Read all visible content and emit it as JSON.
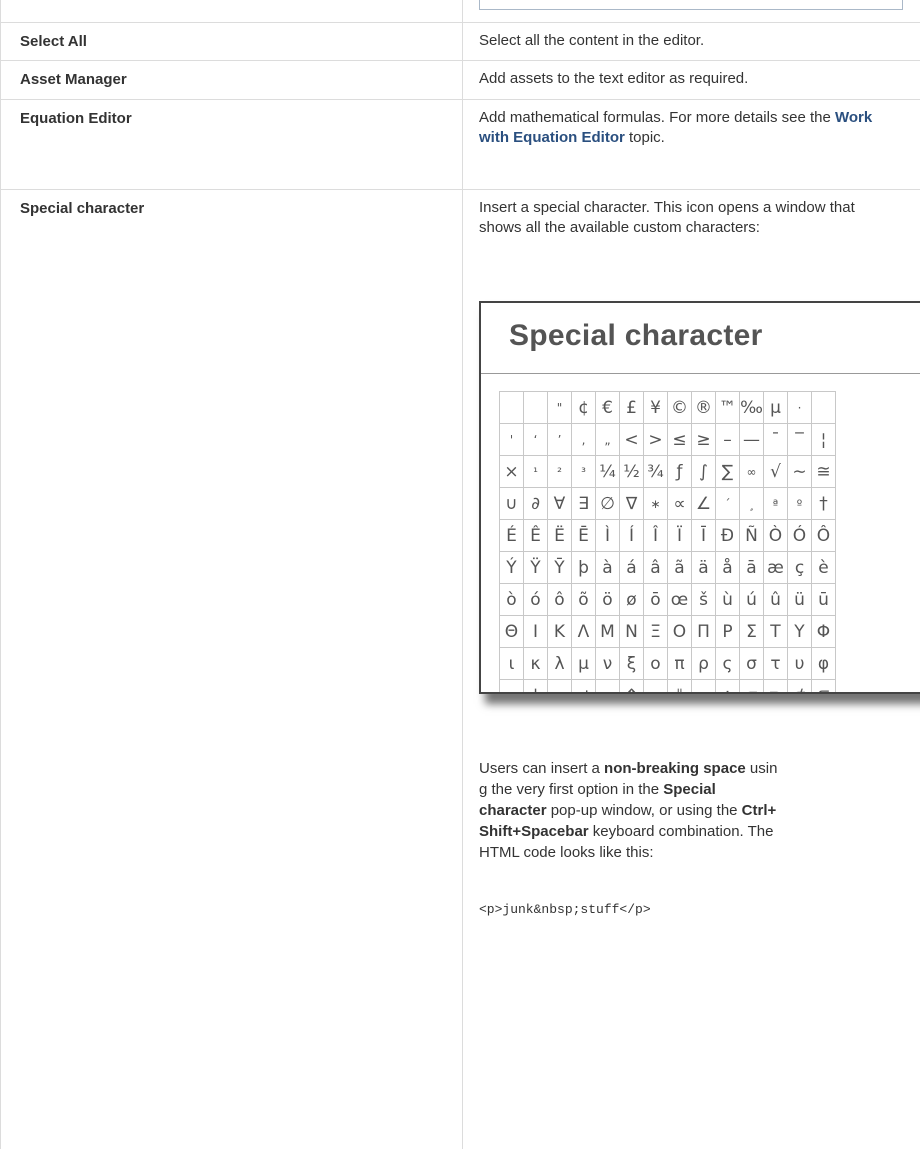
{
  "rows": [
    {
      "label": "Select All",
      "description": "Select all the content in the editor."
    },
    {
      "label": "Asset Manager",
      "description": "Add assets to the text editor as required."
    },
    {
      "label": "Equation Editor",
      "description_pre": "Add mathematical formulas. For more details see the ",
      "link": "Work with Equation Editor",
      "description_post": " topic."
    },
    {
      "label": "Special character",
      "description": "Insert a special character. This icon opens a window that shows all the available custom characters:"
    }
  ],
  "dialog": {
    "title": "Special character",
    "grid": [
      [
        " ",
        " ",
        "\"",
        "¢",
        "€",
        "£",
        "¥",
        "©",
        "®",
        "™",
        "‰",
        "µ",
        "·",
        " "
      ],
      [
        "'",
        "‘",
        "’",
        ",",
        "„",
        "<",
        ">",
        "≤",
        "≥",
        "–",
        "—",
        "¯",
        "‾",
        "¦"
      ],
      [
        "×",
        "¹",
        "²",
        "³",
        "¼",
        "½",
        "¾",
        "ƒ",
        "∫",
        "∑",
        "∞",
        "√",
        "∼",
        "≅"
      ],
      [
        "∪",
        "∂",
        "∀",
        "∃",
        "∅",
        "∇",
        "∗",
        "∝",
        "∠",
        "´",
        "¸",
        "ª",
        "º",
        "†"
      ],
      [
        "É",
        "Ê",
        "Ë",
        "Ē",
        "Ì",
        "Í",
        "Î",
        "Ï",
        "Ī",
        "Ð",
        "Ñ",
        "Ò",
        "Ó",
        "Ô"
      ],
      [
        "Ý",
        "Ÿ",
        "Ȳ",
        "þ",
        "à",
        "á",
        "â",
        "ã",
        "ä",
        "å",
        "ā",
        "æ",
        "ç",
        "è"
      ],
      [
        "ò",
        "ó",
        "ô",
        "õ",
        "ö",
        "ø",
        "ō",
        "œ",
        "š",
        "ù",
        "ú",
        "û",
        "ü",
        "ū"
      ],
      [
        "Θ",
        "Ι",
        "Κ",
        "Λ",
        "Μ",
        "Ν",
        "Ξ",
        "Ο",
        "Π",
        "Ρ",
        "Σ",
        "Τ",
        "Υ",
        "Φ"
      ],
      [
        "ι",
        "κ",
        "λ",
        "μ",
        "ν",
        "ξ",
        "ο",
        "π",
        "ρ",
        "ς",
        "σ",
        "τ",
        "υ",
        "φ"
      ],
      [
        "→",
        "↓",
        "↔",
        "↵",
        "⇐",
        "⇑",
        "⇒",
        "⇓",
        "⇔",
        "∴",
        "⊂",
        "⊃",
        "⊄",
        "⊆"
      ],
      [
        "◊",
        "♠",
        "♣",
        "♥",
        "♦",
        "",
        "",
        "",
        "",
        "",
        "",
        "",
        "",
        ""
      ]
    ]
  },
  "nbsp_note": {
    "p1": "Users can insert a ",
    "b1": "non-breaking space",
    "p2": " usin",
    "p3": "g the very first option in the ",
    "b2a": "Special",
    "b2b": "character",
    "p4": " pop-up window, or using the ",
    "b3a": "Ctrl+",
    "b3b": "Shift+Spacebar",
    "p5": " keyboard combination. The",
    "p6": "HTML code looks like this:",
    "code": "<p>junk&nbsp;stuff</p>"
  }
}
